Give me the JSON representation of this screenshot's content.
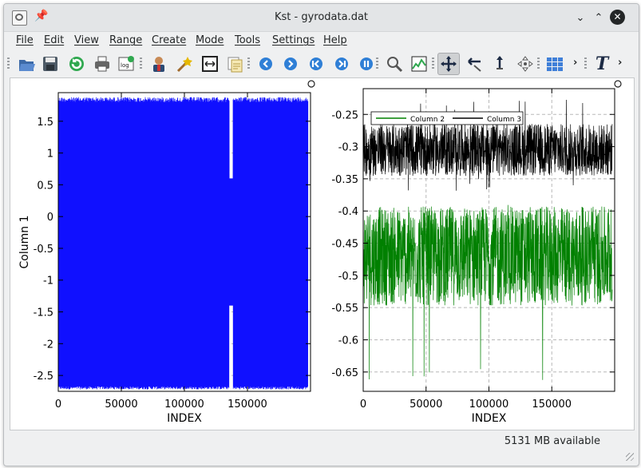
{
  "window": {
    "title": "Kst - gyrodata.dat"
  },
  "titlebar_buttons": {
    "minimize": "⌄",
    "maximize": "⌃",
    "close": "✕"
  },
  "menu": [
    "File",
    "Edit",
    "View",
    "Range",
    "Create",
    "Mode",
    "Tools",
    "Settings",
    "Help"
  ],
  "toolbar": {
    "icons": [
      "open-icon",
      "save-icon",
      "reload-icon",
      "print-icon",
      "log-icon",
      "data-manager-icon",
      "data-wizard-icon",
      "change-data-file-icon",
      "change-range-icon",
      "back-icon",
      "forward-icon",
      "first-icon",
      "last-icon",
      "pause-icon",
      "zoom-icon",
      "curve-icon",
      "layout-mode-icon",
      "zoom-mode-icon",
      "pan-mode-icon",
      "move-icon",
      "tile-icon",
      "text-icon"
    ],
    "label_tool": "T",
    "more": "›"
  },
  "status": {
    "memory": "5131 MB available"
  },
  "chart_data": [
    {
      "type": "line",
      "title": "",
      "xlabel": "INDEX",
      "ylabel": "Column 1",
      "xlim": [
        0,
        200000
      ],
      "ylim": [
        -2.75,
        1.95
      ],
      "x_ticks": [
        "0",
        "50000",
        "100000",
        "150000"
      ],
      "y_ticks": [
        "1.5",
        "1",
        "0.5",
        "0",
        "-0.5",
        "-1",
        "-1.5",
        "-2",
        "-2.5"
      ],
      "grid": true,
      "series": [
        {
          "color": "#1010ff",
          "description": "dense oscillation between about -2.7 and 1.88 across index 0–198000, gap near index 137000",
          "min": -2.72,
          "max": 1.88
        }
      ]
    },
    {
      "type": "line",
      "title": "",
      "xlabel": "INDEX",
      "ylabel": "",
      "xlim": [
        0,
        200000
      ],
      "ylim": [
        -0.68,
        -0.21
      ],
      "x_ticks": [
        "0",
        "50000",
        "100000",
        "150000"
      ],
      "y_ticks": [
        "-0.25",
        "-0.3",
        "-0.35",
        "-0.4",
        "-0.45",
        "-0.5",
        "-0.55",
        "-0.6",
        "-0.65"
      ],
      "grid": true,
      "legend": "top-left",
      "series": [
        {
          "name": "Column 2",
          "color": "#008000",
          "center": -0.47,
          "min": -0.665,
          "max": -0.39
        },
        {
          "name": "Column 3",
          "color": "#000000",
          "center": -0.305,
          "min": -0.37,
          "max": -0.225
        }
      ]
    }
  ]
}
